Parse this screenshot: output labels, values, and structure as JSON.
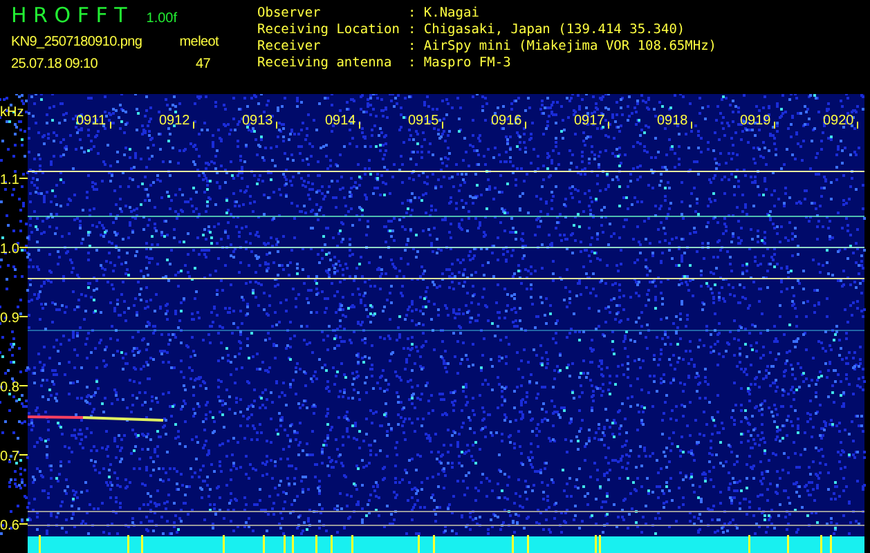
{
  "header": {
    "title": "H R O F F T",
    "version": "1.00f",
    "file_name": "KN9_2507180910.png",
    "timestamp": "25.07.18 09:10",
    "count_label": "meleot",
    "count": "47",
    "info": [
      {
        "label": "Observer",
        "value": ": K.Nagai"
      },
      {
        "label": "Receiving Location",
        "value": ": Chigasaki, Japan (139.414 35.340)"
      },
      {
        "label": "Receiver",
        "value": ": AirSpy mini (Miakejima VOR 108.65MHz)"
      },
      {
        "label": "Receiving antenna",
        "value": ": Maspro FM-3"
      }
    ]
  },
  "plot": {
    "unit": "kHz",
    "time_labels": [
      "0911",
      "0912",
      "0913",
      "0914",
      "0915",
      "0916",
      "0917",
      "0918",
      "0919",
      "0920"
    ],
    "frequency_labels": [
      "1.1",
      "1.0",
      "0.9",
      "0.8",
      "0.7",
      "0.6"
    ]
  }
}
